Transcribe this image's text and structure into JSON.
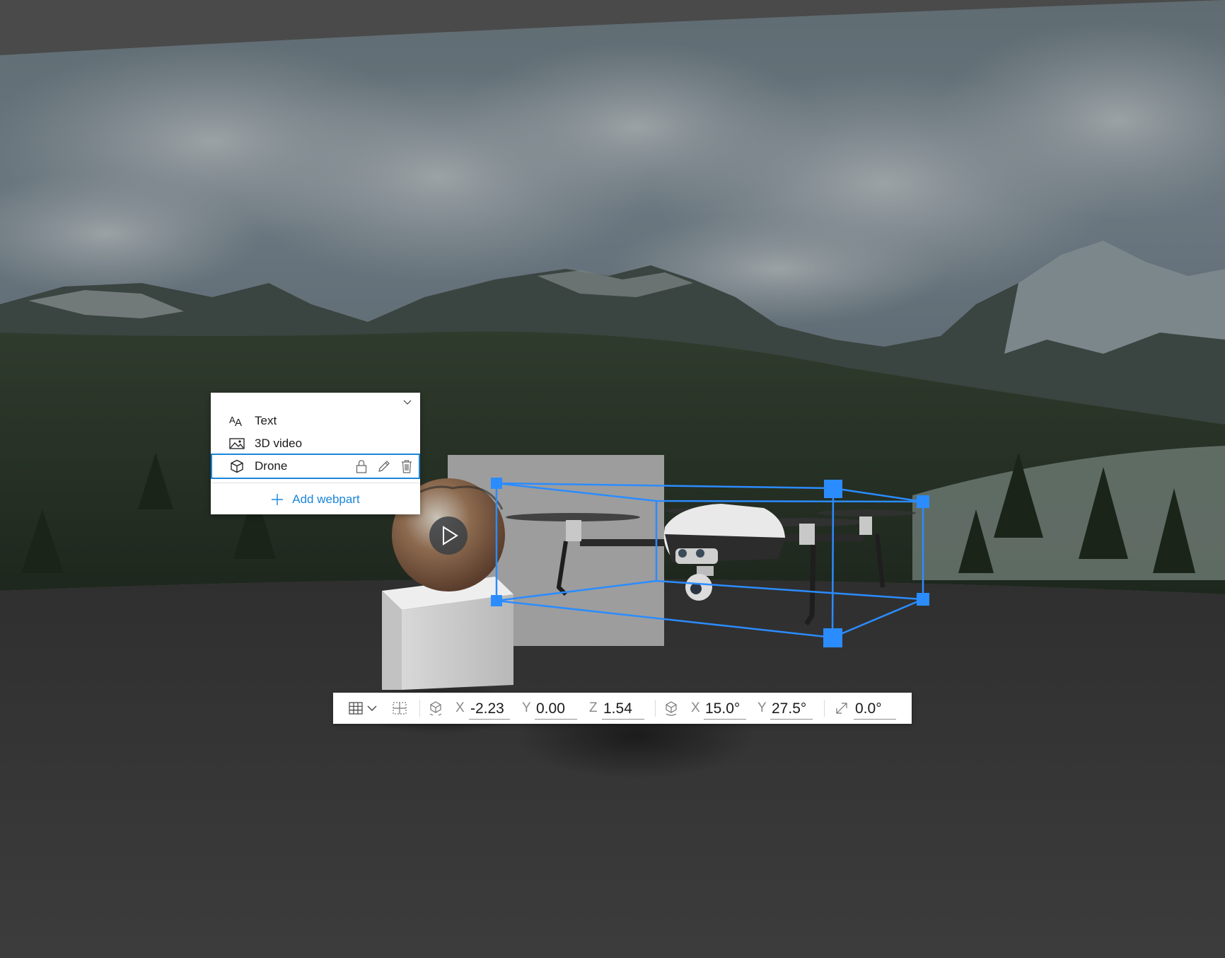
{
  "webpart_panel": {
    "collapse_icon": "chevron-down-icon",
    "items": [
      {
        "label": "Text",
        "icon": "text-icon"
      },
      {
        "label": "3D video",
        "icon": "image-icon"
      },
      {
        "label": "Drone",
        "icon": "cube-icon",
        "selected": true,
        "actions": [
          "lock-icon",
          "pencil-icon",
          "trash-icon"
        ]
      }
    ],
    "add_label": "Add webpart",
    "add_icon": "plus-icon"
  },
  "toolbar": {
    "grid_icon": "grid-icon",
    "snap_icon": "snap-grid-icon",
    "position": {
      "icon": "move-icon",
      "x_label": "X",
      "x_value": "-2.23",
      "y_label": "Y",
      "y_value": "0.00",
      "z_label": "Z",
      "z_value": "1.54"
    },
    "rotation": {
      "icon": "rotate-icon",
      "x_label": "X",
      "x_value": "15.0°",
      "y_label": "Y",
      "y_value": "27.5°"
    },
    "scale": {
      "icon": "resize-icon",
      "value": "0.0°"
    }
  },
  "colors": {
    "accent": "#1a86d9",
    "bounding_box": "#2b8cff",
    "floor": "#3a3a3a",
    "panel_bg": "#ffffff"
  }
}
